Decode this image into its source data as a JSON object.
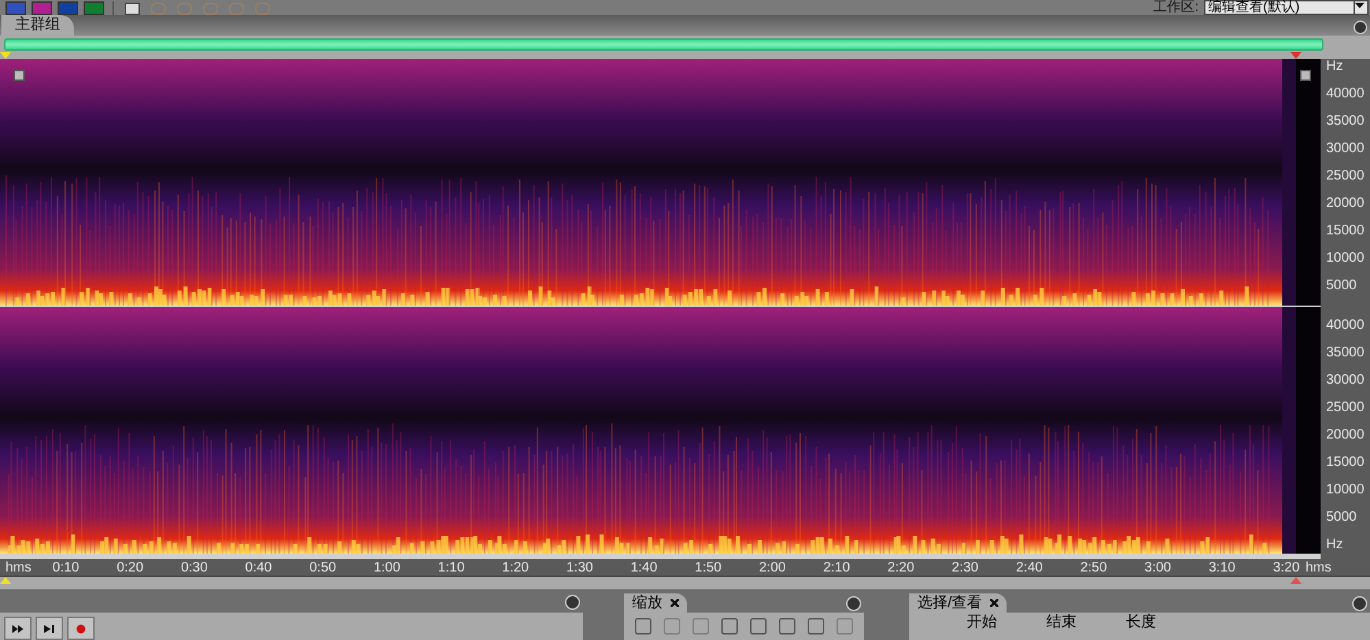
{
  "toolbar": {
    "workspace_label": "工作区:",
    "workspace_value": "编辑查看(默认)"
  },
  "tabs": [
    {
      "label": "主群组",
      "selected": true
    }
  ],
  "spectrogram": {
    "channels": [
      {
        "frequency_labels": [
          "Hz",
          "40000",
          "35000",
          "30000",
          "25000",
          "20000",
          "15000",
          "10000",
          "5000"
        ]
      },
      {
        "frequency_labels": [
          "40000",
          "35000",
          "30000",
          "25000",
          "20000",
          "15000",
          "10000",
          "5000",
          "Hz"
        ]
      }
    ]
  },
  "time_axis": {
    "unit_left": "hms",
    "labels": [
      "0:10",
      "0:20",
      "0:30",
      "0:40",
      "0:50",
      "1:00",
      "1:10",
      "1:20",
      "1:30",
      "1:40",
      "1:50",
      "2:00",
      "2:10",
      "2:20",
      "2:30",
      "2:40",
      "2:50",
      "3:00",
      "3:10",
      "3:20"
    ],
    "unit_right": "hms"
  },
  "zoom_panel": {
    "title": "缩放"
  },
  "selection_panel": {
    "title": "选择/查看",
    "columns": [
      "开始",
      "结束",
      "长度"
    ]
  }
}
